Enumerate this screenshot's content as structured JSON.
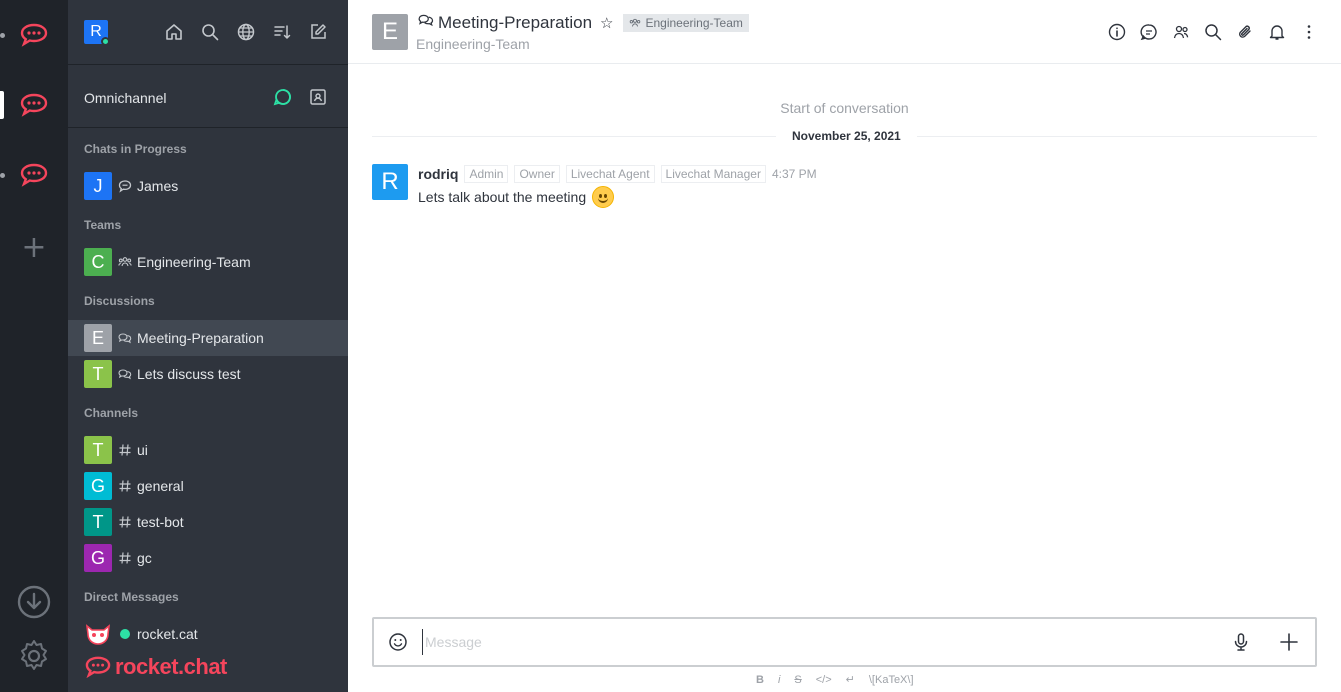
{
  "rail": {
    "servers": [
      "rocket-chat-server-1",
      "rocket-chat-server-2",
      "rocket-chat-server-3"
    ],
    "add_symbol": "+"
  },
  "sidebar": {
    "user_avatar_letter": "R",
    "omnichannel_label": "Omnichannel",
    "sections": {
      "chats_in_progress": "Chats in Progress",
      "teams": "Teams",
      "discussions": "Discussions",
      "channels": "Channels",
      "direct_messages": "Direct Messages"
    },
    "chats": [
      {
        "letter": "J",
        "name": "James",
        "color": "#1d74f5"
      }
    ],
    "teams": [
      {
        "letter": "C",
        "name": "Engineering-Team",
        "color": "#4caf50"
      }
    ],
    "discussions": [
      {
        "letter": "E",
        "name": "Meeting-Preparation",
        "color": "#9ea2a8"
      },
      {
        "letter": "T",
        "name": "Lets discuss test",
        "color": "#8bc34a"
      }
    ],
    "channels": [
      {
        "letter": "T",
        "name": "ui",
        "color": "#8bc34a"
      },
      {
        "letter": "G",
        "name": "general",
        "color": "#00bcd4"
      },
      {
        "letter": "T",
        "name": "test-bot",
        "color": "#009688"
      },
      {
        "letter": "G",
        "name": "gc",
        "color": "#9c27b0"
      }
    ],
    "direct_messages": [
      {
        "name": "rocket.cat"
      }
    ],
    "brand": "rocket.chat"
  },
  "header": {
    "avatar_letter": "E",
    "title": "Meeting-Preparation",
    "team_tag": "Engineering-Team",
    "subtitle": "Engineering-Team"
  },
  "conversation": {
    "start_text": "Start of conversation",
    "date": "November 25, 2021",
    "messages": [
      {
        "avatar_letter": "R",
        "user": "rodriq",
        "roles": [
          "Admin",
          "Owner",
          "Livechat Agent",
          "Livechat Manager"
        ],
        "time": "4:37 PM",
        "text": "Lets talk about the meeting"
      }
    ]
  },
  "composer": {
    "placeholder": "Message",
    "format": [
      "B",
      "i",
      "S",
      "</>",
      "↵",
      "\\[KaTeX\\]"
    ]
  },
  "colors": {
    "rail_bg": "#1f2329",
    "sidebar_bg": "#2f343d",
    "brand_red": "#f5455c",
    "online_green": "#2de0a5"
  }
}
